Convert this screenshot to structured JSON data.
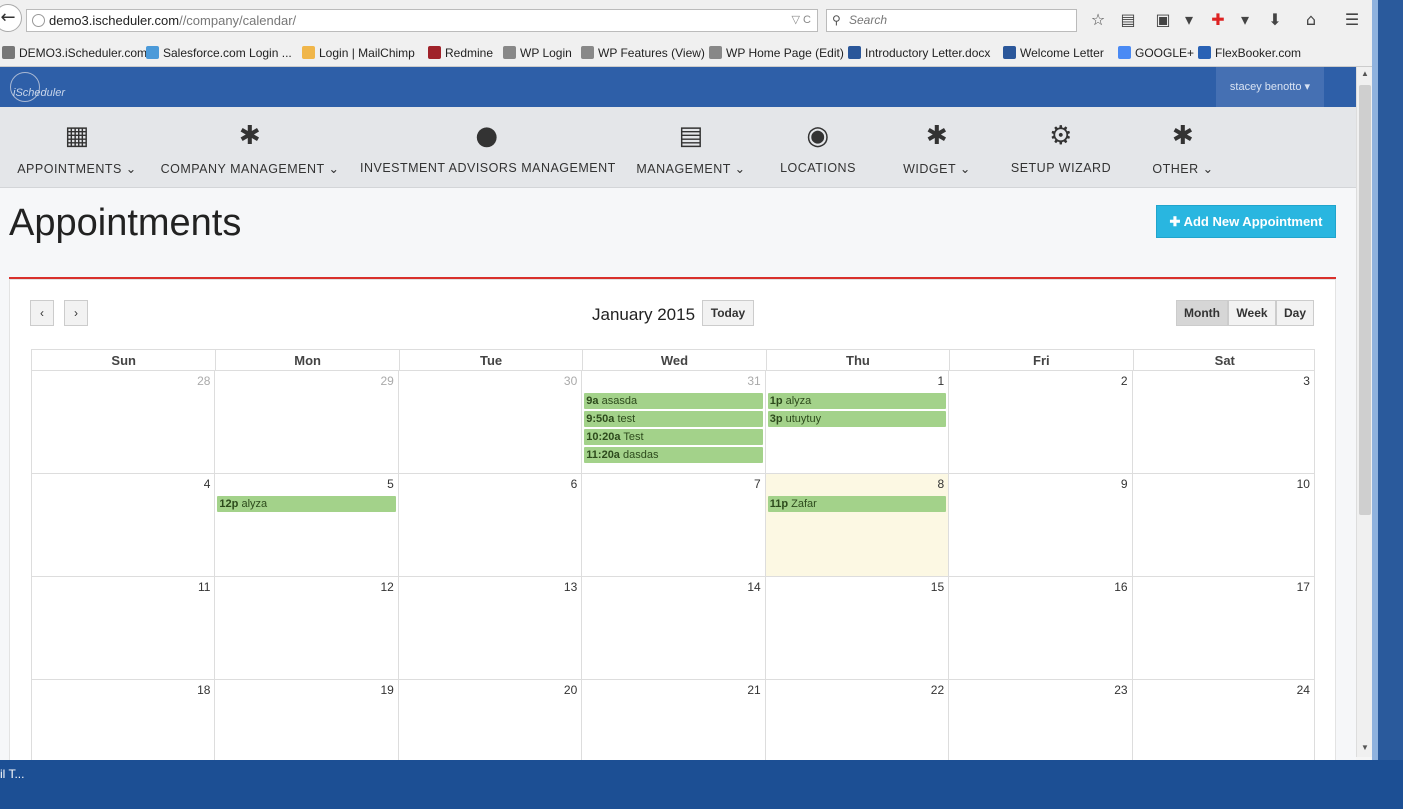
{
  "browser": {
    "url_host": "demo3.ischeduler.com",
    "url_path": "//company/calendar/",
    "search_placeholder": "Search",
    "bookmarks": [
      {
        "label": "DEMO3.iScheduler.com",
        "color": "#777"
      },
      {
        "label": "Salesforce.com Login ...",
        "color": "#4b9ad9"
      },
      {
        "label": "Login | MailChimp",
        "color": "#f0b64a"
      },
      {
        "label": "Redmine",
        "color": "#a0222a"
      },
      {
        "label": "WP Login",
        "color": "#888"
      },
      {
        "label": "WP Features (View)",
        "color": "#888"
      },
      {
        "label": "WP Home Page (Edit)",
        "color": "#888"
      },
      {
        "label": "Introductory Letter.docx",
        "color": "#2b579a"
      },
      {
        "label": "Welcome Letter",
        "color": "#2b579a"
      },
      {
        "label": "GOOGLE+",
        "color": "#4a8af4"
      },
      {
        "label": "FlexBooker.com",
        "color": "#2a62b5"
      }
    ]
  },
  "app": {
    "logo_text": "iScheduler",
    "user_name": "stacey benotto"
  },
  "nav": [
    {
      "label": "APPOINTMENTS",
      "caret": true,
      "icon": "calendar-icon"
    },
    {
      "label": "COMPANY MANAGEMENT",
      "caret": true,
      "icon": "asterisk-icon"
    },
    {
      "label": "INVESTMENT ADVISORS MANAGEMENT",
      "caret": false,
      "icon": "user-icon"
    },
    {
      "label": "MANAGEMENT",
      "caret": true,
      "icon": "list-icon"
    },
    {
      "label": "LOCATIONS",
      "caret": false,
      "icon": "globe-icon"
    },
    {
      "label": "WIDGET",
      "caret": true,
      "icon": "asterisk-icon"
    },
    {
      "label": "SETUP WIZARD",
      "caret": false,
      "icon": "gears-icon"
    },
    {
      "label": "OTHER",
      "caret": true,
      "icon": "asterisk-icon"
    }
  ],
  "page": {
    "title": "Appointments",
    "add_button": "Add New Appointment"
  },
  "calendar": {
    "title": "January 2015",
    "today_label": "Today",
    "prev_label": "‹",
    "next_label": "›",
    "views": [
      "Month",
      "Week",
      "Day"
    ],
    "active_view": "Month",
    "weekdays": [
      "Sun",
      "Mon",
      "Tue",
      "Wed",
      "Thu",
      "Fri",
      "Sat"
    ],
    "weeks": [
      [
        {
          "num": "28",
          "other": true,
          "events": []
        },
        {
          "num": "29",
          "other": true,
          "events": []
        },
        {
          "num": "30",
          "other": true,
          "events": []
        },
        {
          "num": "31",
          "other": true,
          "events": [
            {
              "time": "9a",
              "title": "asasda"
            },
            {
              "time": "9:50a",
              "title": "test"
            },
            {
              "time": "10:20a",
              "title": "Test"
            },
            {
              "time": "11:20a",
              "title": "dasdas"
            }
          ]
        },
        {
          "num": "1",
          "events": [
            {
              "time": "1p",
              "title": "alyza"
            },
            {
              "time": "3p",
              "title": "utuytuy"
            }
          ]
        },
        {
          "num": "2",
          "events": []
        },
        {
          "num": "3",
          "events": []
        }
      ],
      [
        {
          "num": "4",
          "events": []
        },
        {
          "num": "5",
          "events": [
            {
              "time": "12p",
              "title": "alyza"
            }
          ]
        },
        {
          "num": "6",
          "events": []
        },
        {
          "num": "7",
          "events": []
        },
        {
          "num": "8",
          "today": true,
          "events": [
            {
              "time": "11p",
              "title": "Zafar"
            }
          ]
        },
        {
          "num": "9",
          "events": []
        },
        {
          "num": "10",
          "events": []
        }
      ],
      [
        {
          "num": "11",
          "events": []
        },
        {
          "num": "12",
          "events": []
        },
        {
          "num": "13",
          "events": []
        },
        {
          "num": "14",
          "events": []
        },
        {
          "num": "15",
          "events": []
        },
        {
          "num": "16",
          "events": []
        },
        {
          "num": "17",
          "events": []
        }
      ],
      [
        {
          "num": "18",
          "events": []
        },
        {
          "num": "19",
          "events": []
        },
        {
          "num": "20",
          "events": []
        },
        {
          "num": "21",
          "events": []
        },
        {
          "num": "22",
          "events": []
        },
        {
          "num": "23",
          "events": []
        },
        {
          "num": "24",
          "events": []
        }
      ]
    ]
  },
  "taskbar": {
    "label": "il T..."
  }
}
